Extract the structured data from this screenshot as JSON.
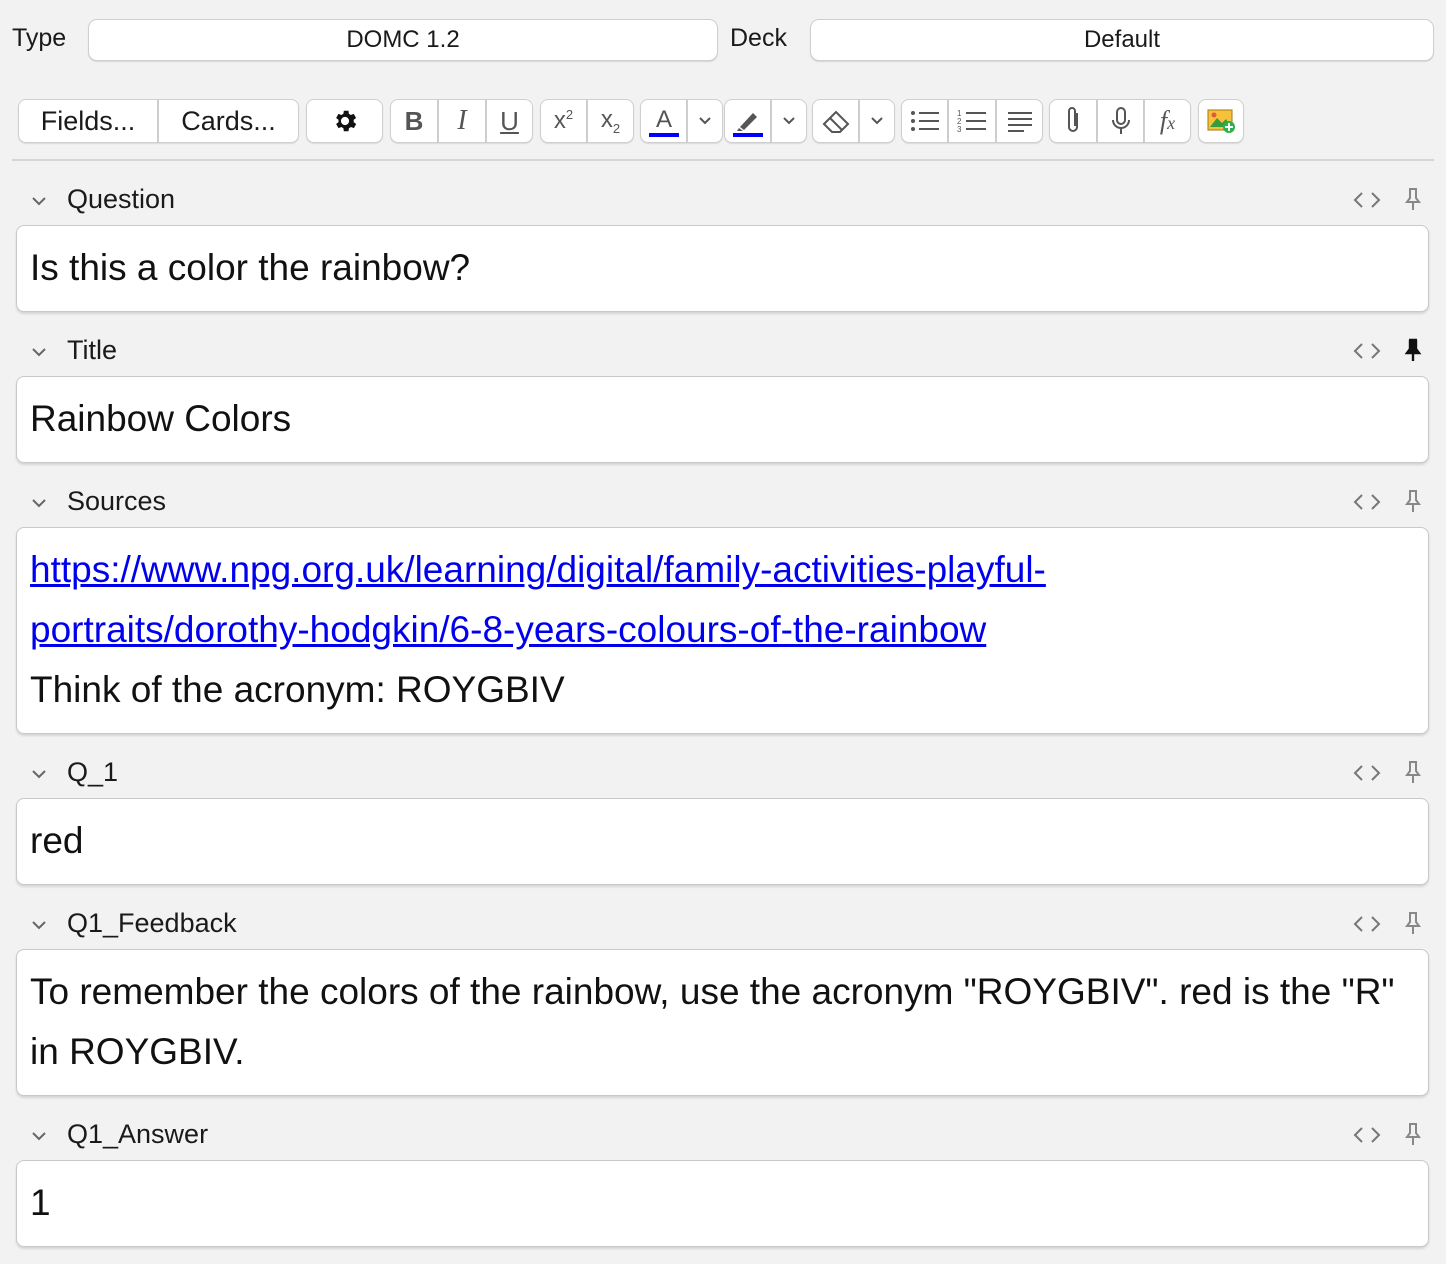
{
  "top": {
    "type_label": "Type",
    "type_value": "DOMC 1.2",
    "deck_label": "Deck",
    "deck_value": "Default"
  },
  "toolbar": {
    "fields_label": "Fields...",
    "cards_label": "Cards...",
    "text_color": "#0000ff",
    "highlight_color": "#0000ff"
  },
  "fields": [
    {
      "name": "Question",
      "content": "Is this a color the rainbow?",
      "pinned": false
    },
    {
      "name": "Title",
      "content": "Rainbow Colors",
      "pinned": true
    },
    {
      "name": "Sources",
      "link": "https://www.npg.org.uk/learning/digital/family-activities-playful-portraits/dorothy-hodgkin/6-8-years-colours-of-the-rainbow",
      "link_line1": "https://www.npg.org.uk/learning/digital/family-activities-playful-",
      "link_line2": "portraits/dorothy-hodgkin/6-8-years-colours-of-the-rainbow",
      "content": "Think of the acronym: ROYGBIV",
      "pinned": false
    },
    {
      "name": "Q_1",
      "content": "red",
      "pinned": false
    },
    {
      "name": "Q1_Feedback",
      "content": "To remember the colors of the rainbow, use the acronym \"ROYGBIV\". red is the \"R\" in ROYGBIV.",
      "pinned": false
    },
    {
      "name": "Q1_Answer",
      "content": "1",
      "pinned": false
    }
  ]
}
